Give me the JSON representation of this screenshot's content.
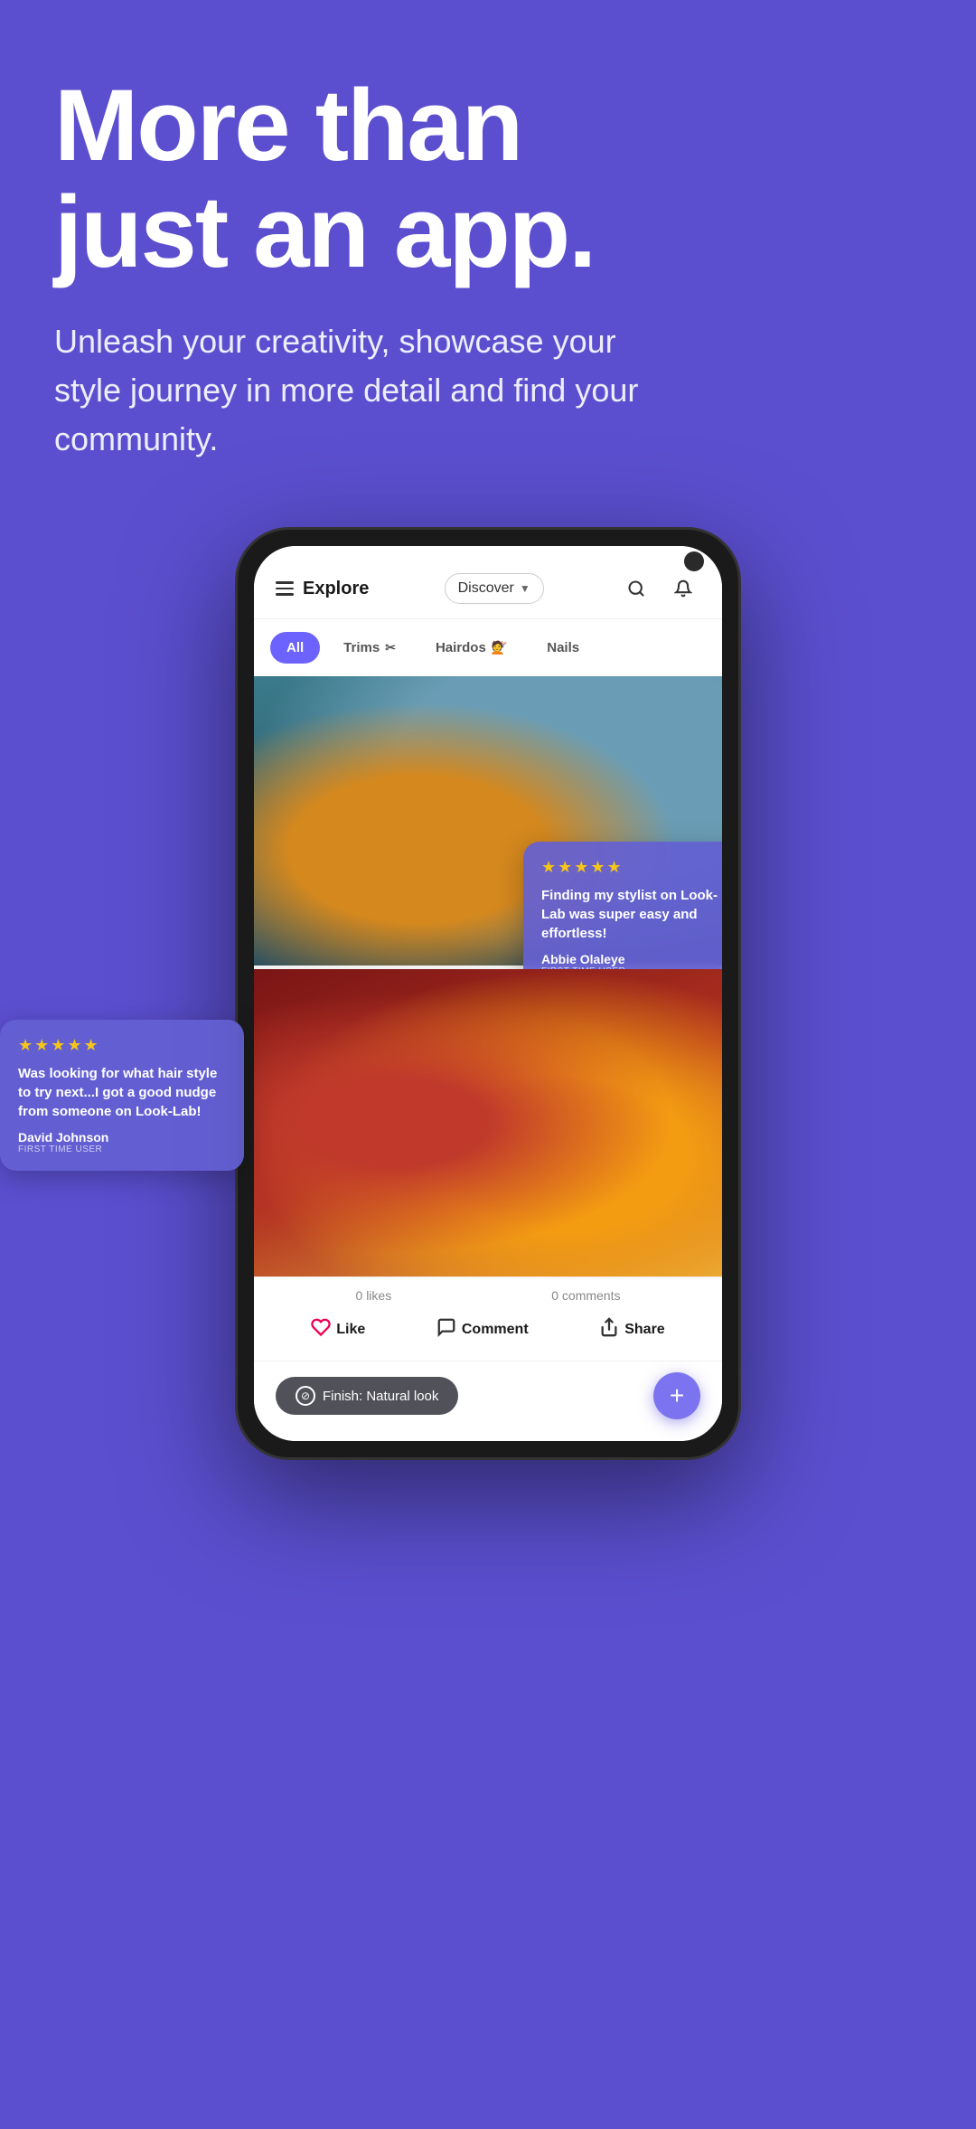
{
  "hero": {
    "title_line1": "More than",
    "title_line2": "just an app.",
    "subtitle": "Unleash your creativity, showcase your style journey in more detail and find your community."
  },
  "app": {
    "topbar": {
      "explore_label": "Explore",
      "dropdown_label": "Discover",
      "search_icon": "search-icon",
      "bell_icon": "bell-icon",
      "menu_icon": "menu-icon"
    },
    "tabs": [
      {
        "label": "All",
        "active": true
      },
      {
        "label": "Trims",
        "icon": "✂",
        "active": false
      },
      {
        "label": "Hairdos",
        "icon": "💇",
        "active": false
      },
      {
        "label": "Nails",
        "active": false
      }
    ],
    "review_right": {
      "stars": "★★★★★",
      "text": "Finding my stylist on Look-Lab was super easy and effortless!",
      "name": "Abbie Olaleye",
      "tag": "FIRST TIME USER"
    },
    "review_left": {
      "stars": "★★★★★",
      "text": "Was looking for what hair style to try next...I got a good nudge from someone on Look-Lab!",
      "name": "David Johnson",
      "tag": "FIRST TIME USER"
    },
    "stats": {
      "likes": "0 likes",
      "comments": "0 comments"
    },
    "actions": {
      "like": "Like",
      "comment": "Comment",
      "share": "Share"
    },
    "finish_pill": "Finish: Natural look",
    "fab_label": "+"
  }
}
